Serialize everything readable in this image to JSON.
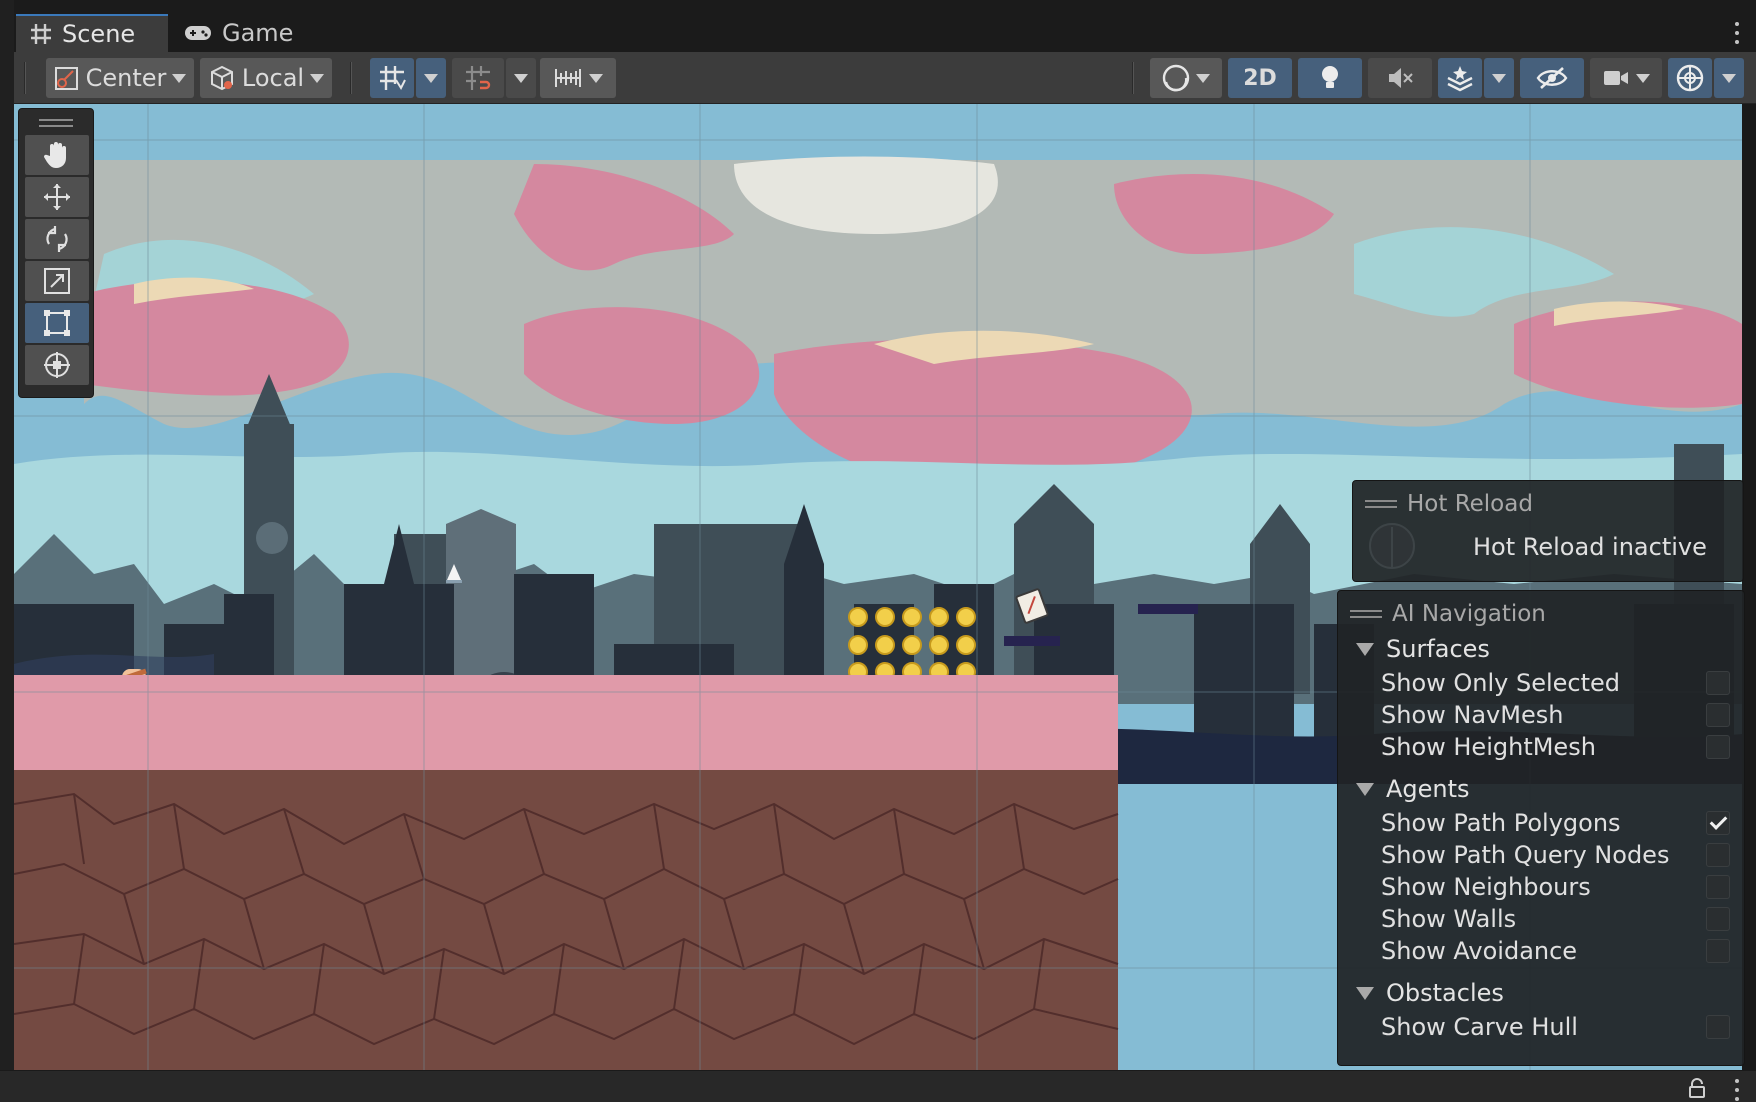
{
  "tabs": [
    {
      "label": "Scene",
      "icon": "grid-hash-icon",
      "active": true
    },
    {
      "label": "Game",
      "icon": "gamepad-icon",
      "active": false
    }
  ],
  "toolbar": {
    "pivot_label": "Center",
    "space_label": "Local",
    "mode_2d_label": "2D"
  },
  "tools": [
    {
      "name": "hand-tool",
      "icon": "hand-icon",
      "active": false
    },
    {
      "name": "move-tool",
      "icon": "move-arrows-icon",
      "active": false
    },
    {
      "name": "rotate-tool",
      "icon": "rotate-icon",
      "active": false
    },
    {
      "name": "scale-tool",
      "icon": "scale-icon",
      "active": false
    },
    {
      "name": "rect-tool",
      "icon": "rect-transform-icon",
      "active": true
    },
    {
      "name": "transform-tool",
      "icon": "transform-icon",
      "active": false
    }
  ],
  "hot_reload": {
    "title": "Hot Reload",
    "status": "Hot Reload inactive"
  },
  "ai_navigation": {
    "title": "AI Navigation",
    "sections": [
      {
        "label": "Surfaces",
        "options": [
          {
            "label": "Show Only Selected",
            "checked": false
          },
          {
            "label": "Show NavMesh",
            "checked": false
          },
          {
            "label": "Show HeightMesh",
            "checked": false
          }
        ]
      },
      {
        "label": "Agents",
        "options": [
          {
            "label": "Show Path Polygons",
            "checked": true
          },
          {
            "label": "Show Path Query Nodes",
            "checked": false
          },
          {
            "label": "Show Neighbours",
            "checked": false
          },
          {
            "label": "Show Walls",
            "checked": false
          },
          {
            "label": "Show Avoidance",
            "checked": false
          }
        ]
      },
      {
        "label": "Obstacles",
        "options": [
          {
            "label": "Show Carve Hull",
            "checked": false
          }
        ]
      }
    ]
  },
  "colors": {
    "sky": "#85bcd4",
    "cloud_pink": "#d4889f",
    "cloud_grey": "#b3bab6",
    "ground_pink": "#e09aa9",
    "dirt": "#744a42",
    "accent_blue": "#46607c"
  }
}
